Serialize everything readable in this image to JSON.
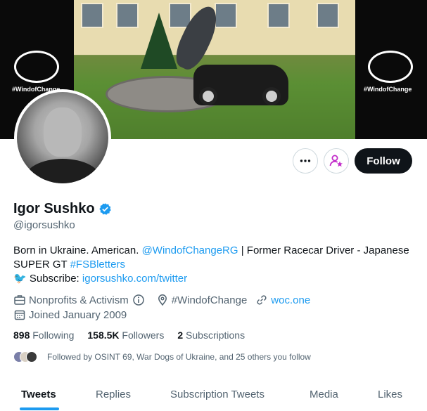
{
  "banner": {
    "left_logo_text": "#WindofChange",
    "right_logo_text": "#WindofChange"
  },
  "profile": {
    "name": "Igor Sushko",
    "handle": "@igorsushko",
    "verified_color": "#1d9bf0"
  },
  "actions": {
    "more_icon": "ellipsis-icon",
    "subscribe_icon": "person-star-icon",
    "follow_label": "Follow"
  },
  "bio": {
    "line1_prefix": "Born in Ukraine. American. ",
    "line1_mention": "@WindofChangeRG",
    "line1_suffix": " | Former Racecar Driver - Japanese",
    "line2_prefix": "SUPER GT ",
    "line2_hashtag": "#FSBletters",
    "line3_emoji": "🐦",
    "line3_prefix": " Subscribe: ",
    "line3_link": "igorsushko.com/twitter"
  },
  "meta": {
    "category": "Nonprofits & Activism",
    "location": "#WindofChange",
    "website": "woc.one",
    "joined": "Joined January 2009"
  },
  "counts": {
    "following_value": "898",
    "following_label": " Following",
    "followers_value": "158.5K",
    "followers_label": " Followers",
    "subscriptions_value": "2",
    "subscriptions_label": " Subscriptions"
  },
  "followed_by": "Followed by OSINT 69, War Dogs of Ukraine, and 25 others you follow",
  "tabs": {
    "tweets": "Tweets",
    "replies": "Replies",
    "subscription_tweets": "Subscription Tweets",
    "media": "Media",
    "likes": "Likes"
  },
  "colors": {
    "accent": "#1d9bf0",
    "text": "#0f1419",
    "secondary": "#536471",
    "subscribe_icon": "#c22bc9"
  }
}
